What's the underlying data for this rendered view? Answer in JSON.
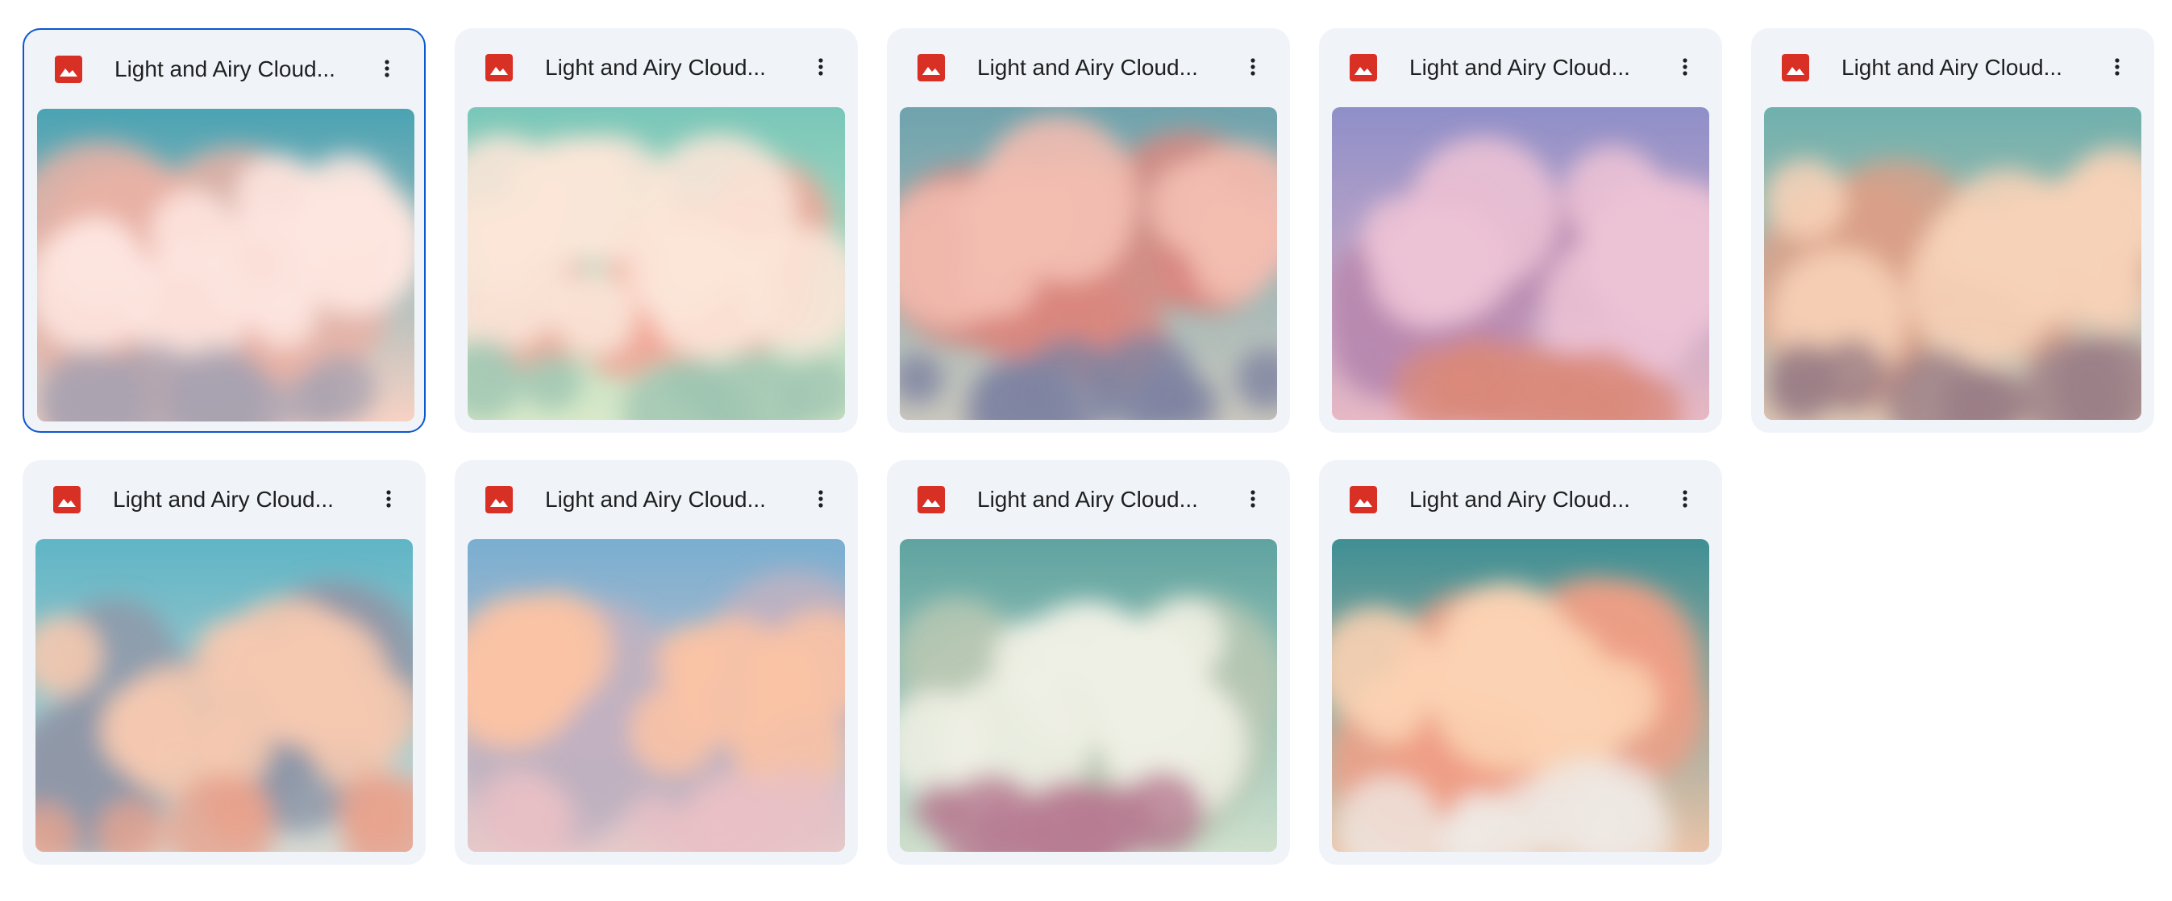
{
  "files": [
    {
      "title": "Light and Airy Cloud...",
      "selected": true,
      "sky_top": "#4aa3b3",
      "sky_bottom": "#f7d2c4",
      "cloud_main": "#fde6df",
      "cloud_shade": "#e9b1a6",
      "cloud_low": "#a9a2b0"
    },
    {
      "title": "Light and Airy Cloud...",
      "selected": false,
      "sky_top": "#79c7b9",
      "sky_bottom": "#d9e9c9",
      "cloud_main": "#fbe5d8",
      "cloud_shade": "#f2a696",
      "cloud_low": "#9fc4b2"
    },
    {
      "title": "Light and Airy Cloud...",
      "selected": false,
      "sky_top": "#6fa3ad",
      "sky_bottom": "#c9c7bd",
      "cloud_main": "#f3bdb0",
      "cloud_shade": "#d9877f",
      "cloud_low": "#7e83a1"
    },
    {
      "title": "Light and Airy Cloud...",
      "selected": false,
      "sky_top": "#8f8fc8",
      "sky_bottom": "#e7b8c4",
      "cloud_main": "#ecc2d5",
      "cloud_shade": "#b889b0",
      "cloud_low": "#d9897a"
    },
    {
      "title": "Light and Airy Cloud...",
      "selected": false,
      "sky_top": "#6fb0ad",
      "sky_bottom": "#e0c9b6",
      "cloud_main": "#f6d2b8",
      "cloud_shade": "#d9a088",
      "cloud_low": "#9a7d86"
    },
    {
      "title": "Light and Airy Cloud...",
      "selected": false,
      "sky_top": "#5fb5c6",
      "sky_bottom": "#d9d9d2",
      "cloud_main": "#f5c9b0",
      "cloud_shade": "#8f98a8",
      "cloud_low": "#e7a38d"
    },
    {
      "title": "Light and Airy Cloud...",
      "selected": false,
      "sky_top": "#7aaed0",
      "sky_bottom": "#e7c9c8",
      "cloud_main": "#f9c3a5",
      "cloud_shade": "#c1b1c1",
      "cloud_low": "#e8c0c6"
    },
    {
      "title": "Light and Airy Cloud...",
      "selected": false,
      "sky_top": "#5fa3a0",
      "sky_bottom": "#cfe0cd",
      "cloud_main": "#eef0e4",
      "cloud_shade": "#b8c8b3",
      "cloud_low": "#b87c92"
    },
    {
      "title": "Light and Airy Cloud...",
      "selected": false,
      "sky_top": "#3f8f94",
      "sky_bottom": "#e9c3a8",
      "cloud_main": "#fbd2b3",
      "cloud_shade": "#ee9f86",
      "cloud_low": "#efe9e3"
    }
  ],
  "colors": {
    "file_icon": "#d93025",
    "card_bg": "#f0f4f9",
    "selected_border": "#0b57d0",
    "title_text": "#1f1f1f"
  },
  "icons": {
    "file_type": "image-file-icon",
    "menu": "more-vert-icon"
  }
}
